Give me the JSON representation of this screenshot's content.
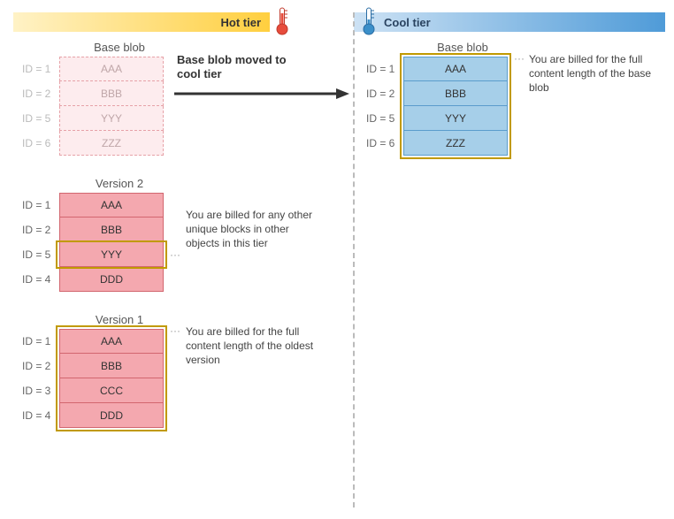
{
  "tiers": {
    "hot": {
      "label": "Hot tier",
      "icon": "thermometer-hot"
    },
    "cool": {
      "label": "Cool tier",
      "icon": "thermometer-cool"
    }
  },
  "groups": {
    "hot_base": {
      "title": "Base blob",
      "rows": [
        {
          "id": "ID = 1",
          "val": "AAA"
        },
        {
          "id": "ID = 2",
          "val": "BBB"
        },
        {
          "id": "ID = 5",
          "val": "YYY"
        },
        {
          "id": "ID = 6",
          "val": "ZZZ"
        }
      ]
    },
    "version2": {
      "title": "Version 2",
      "rows": [
        {
          "id": "ID = 1",
          "val": "AAA"
        },
        {
          "id": "ID = 2",
          "val": "BBB"
        },
        {
          "id": "ID = 5",
          "val": "YYY"
        },
        {
          "id": "ID = 4",
          "val": "DDD"
        }
      ]
    },
    "version1": {
      "title": "Version 1",
      "rows": [
        {
          "id": "ID = 1",
          "val": "AAA"
        },
        {
          "id": "ID = 2",
          "val": "BBB"
        },
        {
          "id": "ID = 3",
          "val": "CCC"
        },
        {
          "id": "ID = 4",
          "val": "DDD"
        }
      ]
    },
    "cool_base": {
      "title": "Base blob",
      "rows": [
        {
          "id": "ID = 1",
          "val": "AAA"
        },
        {
          "id": "ID = 2",
          "val": "BBB"
        },
        {
          "id": "ID = 5",
          "val": "YYY"
        },
        {
          "id": "ID = 6",
          "val": "ZZZ"
        }
      ]
    }
  },
  "annotations": {
    "arrow_label": "Base blob moved to cool tier",
    "cool_full": "You are billed for the full content length of the base blob",
    "v2_unique": "You are billed for any other unique blocks in other objects in this tier",
    "v1_full": "You are billed for the full content length of the oldest version"
  },
  "colors": {
    "hot_banner_from": "#fff2c6",
    "hot_banner_to": "#ffcf3f",
    "cool_banner_from": "#cde2f4",
    "cool_banner_to": "#4f9bd8",
    "hot_ghost_fill": "#fdecee",
    "hot_ghost_border": "#e6a2a8",
    "hot_solid_fill": "#f4a8af",
    "hot_solid_border": "#d2666f",
    "cool_fill": "#a6cfe9",
    "cool_border": "#5a9ccc",
    "gold": "#c19a00"
  }
}
